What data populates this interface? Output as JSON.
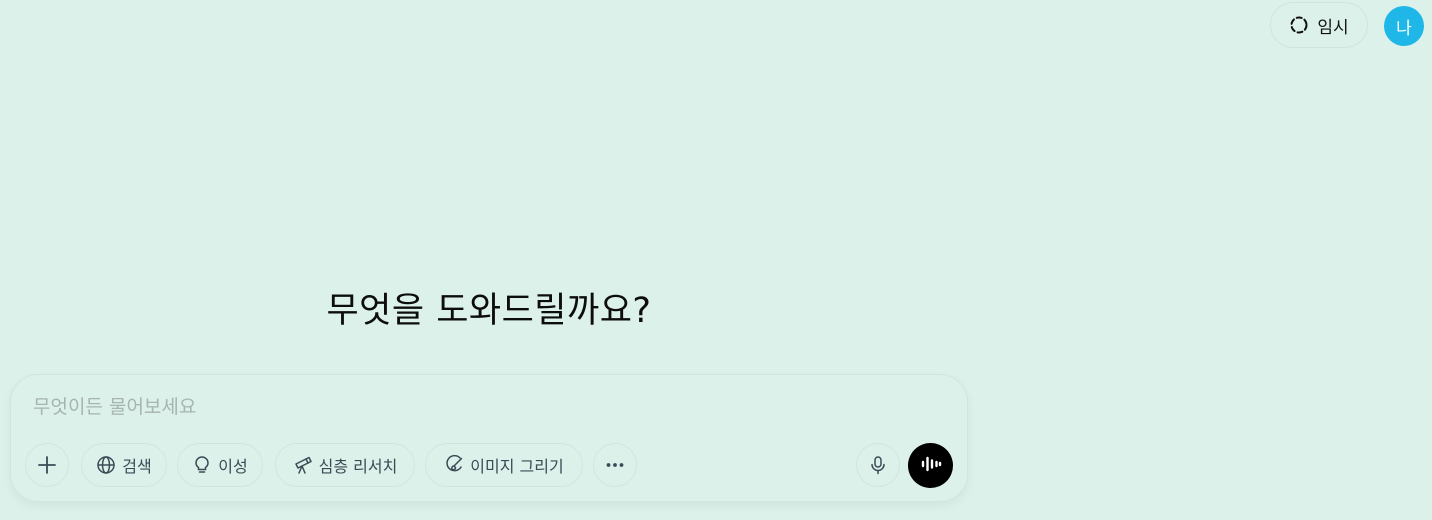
{
  "header": {
    "temporary_label": "임시",
    "avatar_initial": "나"
  },
  "main": {
    "headline": "무엇을 도와드릴까요?"
  },
  "composer": {
    "placeholder": "무엇이든 물어보세요",
    "tools": {
      "search_label": "검색",
      "reason_label": "이성",
      "deep_research_label": "심층 리서치",
      "create_image_label": "이미지 그리기"
    }
  },
  "colors": {
    "background": "#dcf1ea",
    "avatar": "#1fb6e8",
    "voice_button": "#000000",
    "tool_text": "#3c4a56",
    "placeholder": "#a7b4b0"
  },
  "icons": {
    "temporary": "dashed-circle-icon",
    "plus": "plus-icon",
    "search": "globe-icon",
    "reason": "lightbulb-icon",
    "deep_research": "telescope-icon",
    "create_image": "paint-brush-icon",
    "more": "more-dots-icon",
    "mic": "microphone-icon",
    "voice": "voice-waveform-icon"
  }
}
